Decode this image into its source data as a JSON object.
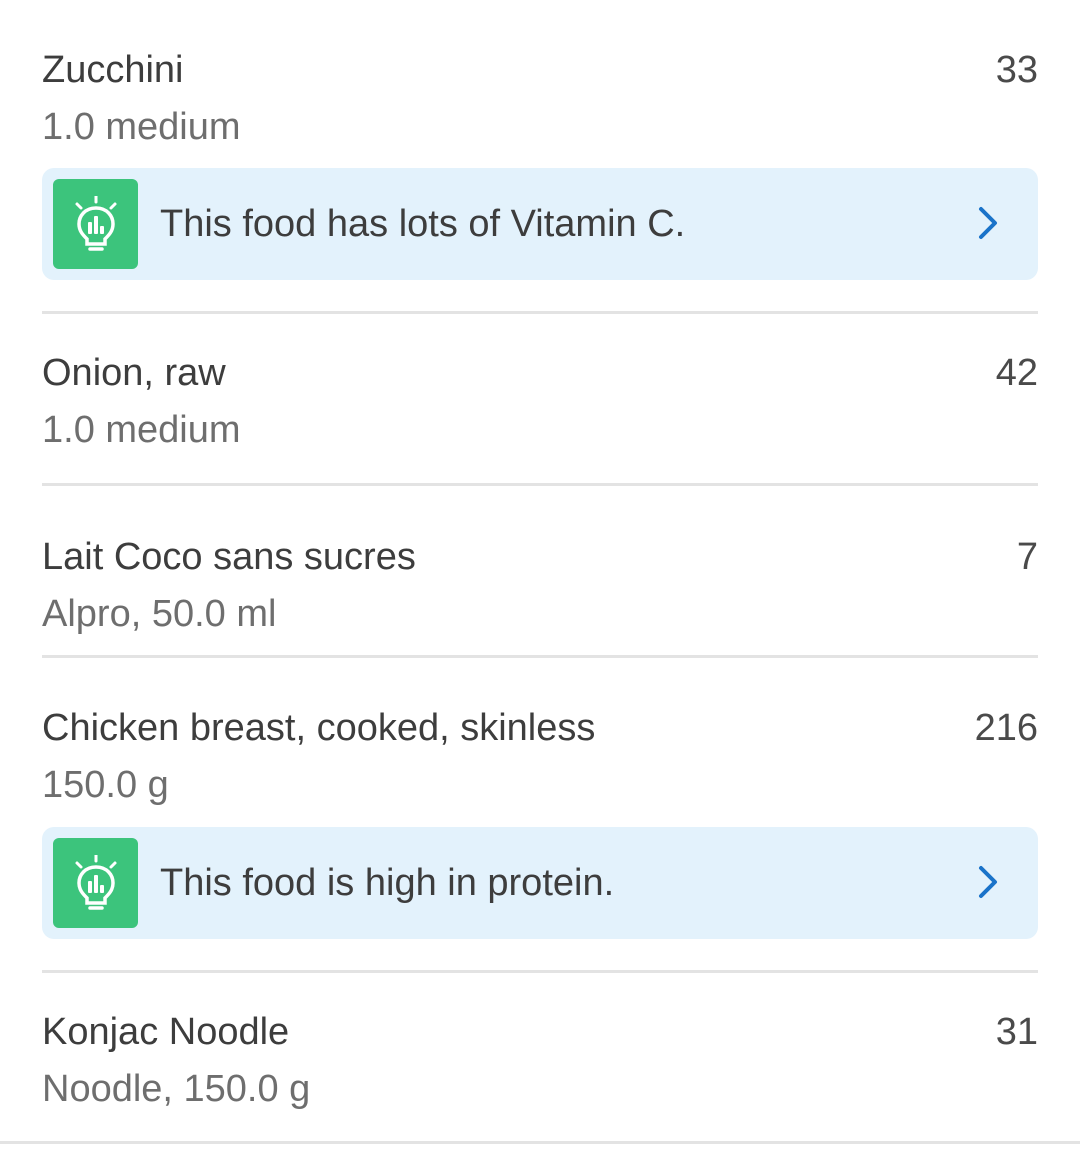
{
  "entries": [
    {
      "name": "Zucchini",
      "serving": "1.0 medium",
      "calories": "33",
      "tip": "This food has lots of Vitamin C."
    },
    {
      "name": "Onion, raw",
      "serving": "1.0 medium",
      "calories": "42"
    },
    {
      "name": "Lait Coco sans sucres",
      "serving": "Alpro, 50.0 ml",
      "calories": "7"
    },
    {
      "name": "Chicken breast, cooked, skinless",
      "serving": "150.0 g",
      "calories": "216",
      "tip": "This food is high in protein."
    },
    {
      "name": "Konjac Noodle",
      "serving": "Noodle, 150.0 g",
      "calories": "31"
    }
  ],
  "icons": {
    "tip_icon": "lightbulb-chart-icon",
    "tip_chevron": "chevron-right-icon"
  },
  "colors": {
    "tip_background": "#e3f2fc",
    "tip_icon_background": "#3cc47c",
    "chevron": "#1a73c9",
    "divider": "#e3e3e3"
  }
}
